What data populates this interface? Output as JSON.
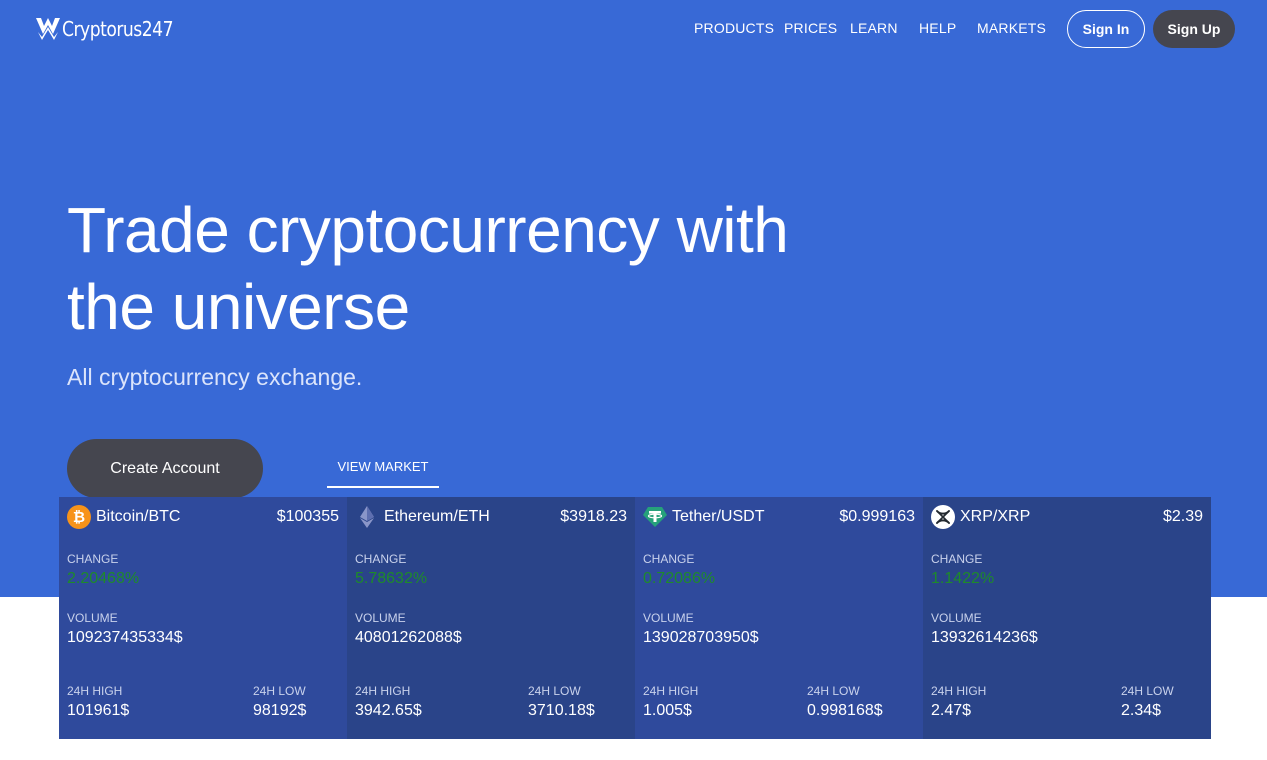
{
  "header": {
    "logo_text": "Cryptorus247",
    "nav": [
      "PRODUCTS",
      "PRICES",
      "LEARN",
      "HELP",
      "MARKETS"
    ],
    "sign_in": "Sign In",
    "sign_up": "Sign Up"
  },
  "hero": {
    "headline": "Trade cryptocurrency with the universe",
    "subtitle": "All cryptocurrency exchange.",
    "create_account": "Create Account",
    "view_market": "VIEW MARKET"
  },
  "labels": {
    "change": "CHANGE",
    "volume": "VOLUME",
    "high": "24H HIGH",
    "low": "24H LOW"
  },
  "tickers": [
    {
      "icon": "bitcoin-icon",
      "pair": "Bitcoin/BTC",
      "price": "$100355",
      "change": "2.20468%",
      "volume": "109237435334$",
      "high": "101961$",
      "low": "98192$"
    },
    {
      "icon": "ethereum-icon",
      "pair": "Ethereum/ETH",
      "price": "$3918.23",
      "change": "5.78632%",
      "volume": "40801262088$",
      "high": "3942.65$",
      "low": "3710.18$"
    },
    {
      "icon": "tether-icon",
      "pair": "Tether/USDT",
      "price": "$0.999163",
      "change": "0.72086%",
      "volume": "139028703950$",
      "high": "1.005$",
      "low": "0.998168$"
    },
    {
      "icon": "xrp-icon",
      "pair": "XRP/XRP",
      "price": "$2.39",
      "change": "1.1422%",
      "volume": "13932614236$",
      "high": "2.47$",
      "low": "2.34$"
    }
  ],
  "colors": {
    "hero_bg": "#3869d6",
    "ticker_bg": "#2f4a9c",
    "button_dark": "#45464f",
    "change_green": "#1e8b2a",
    "bitcoin": "#f7931a",
    "tether": "#26a17b"
  }
}
